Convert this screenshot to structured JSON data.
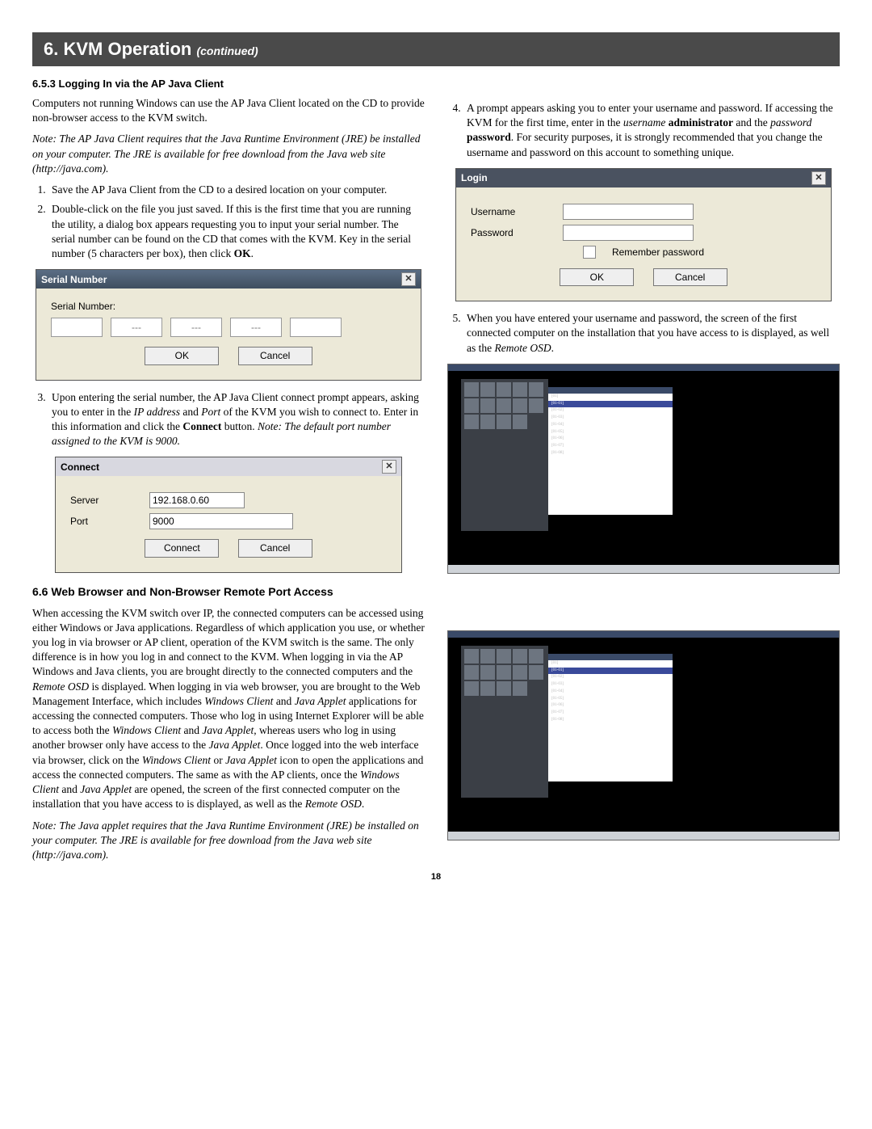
{
  "header": {
    "title": "6. KVM Operation",
    "continued": "(continued)"
  },
  "sec653_title": "6.5.3 Logging In via the AP Java Client",
  "left": {
    "p1": "Computers not running Windows can use the AP Java Client located on the CD to provide non-browser access to the KVM switch.",
    "note1": "Note: The AP Java Client requires that the Java Runtime Environment (JRE) be installed on your computer. The JRE is available for free download from the Java web site (http://java.com).",
    "step1": "Save the AP Java Client from the CD to a desired location on your computer.",
    "step2_pre": "Double-click on the file you just saved. If this is the first time that you are running the utility, a dialog box appears requesting you to input your serial number. The serial number can be found on the CD that comes with the KVM. Key in the serial number (5 characters per box), then click ",
    "step2_bold": "OK",
    "step2_post": ".",
    "step3_pre": "Upon entering the serial number, the AP Java Client connect prompt appears, asking you to enter in the ",
    "step3_i1": "IP address",
    "step3_mid1": " and ",
    "step3_i2": "Port",
    "step3_mid2": " of the KVM you wish to connect to. Enter in this information and click the ",
    "step3_b1": "Connect",
    "step3_mid3": " button. ",
    "step3_note": "Note: The default port number assigned to the KVM is 9000."
  },
  "serial_dialog": {
    "title": "Serial Number",
    "label": "Serial Number:",
    "dash": "---",
    "ok": "OK",
    "cancel": "Cancel"
  },
  "connect_dialog": {
    "title": "Connect",
    "server_label": "Server",
    "server_value": "192.168.0.60",
    "port_label": "Port",
    "port_value": "9000",
    "connect": "Connect",
    "cancel": "Cancel"
  },
  "right": {
    "step4_pre": "A prompt appears asking you to enter your username and password. If accessing the KVM for the first time, enter in the ",
    "step4_i1": "username",
    "sp": " ",
    "step4_b1": "administrator",
    "step4_mid1": " and the ",
    "step4_i2": "password",
    "step4_b2": "password",
    "step4_post": ". For security purposes, it is strongly recommended that you change the username and password on this account to something unique.",
    "step5_pre": "When you have entered your username and password, the screen of the first connected computer on the installation that you have access to is displayed, as well as the ",
    "step5_i1": "Remote OSD",
    "step5_post": "."
  },
  "login_dialog": {
    "title": "Login",
    "username": "Username",
    "password": "Password",
    "remember": "Remember password",
    "ok": "OK",
    "cancel": "Cancel"
  },
  "osd_list": [
    "[01]",
    "[01-01]",
    "[01-02]",
    "[01-03]",
    "[01-04]",
    "[01-05]",
    "[01-06]",
    "[01-07]",
    "[01-08]"
  ],
  "sec66": {
    "title": "6.6 Web Browser and Non-Browser Remote Port Access",
    "p_pre": "When accessing the KVM switch over IP, the connected computers can be accessed using either Windows or Java applications. Regardless of which application you use, or whether you log in via browser or AP client, operation of the KVM switch is the same. The only difference is in how you log in and connect to the KVM. When logging in via the AP Windows and Java clients, you are brought directly to the connected computers and the ",
    "i1": "Remote OSD",
    "m1": " is displayed. When logging in via web browser, you are brought to the Web Management Interface, which includes ",
    "i2": "Windows Client",
    "m2": " and ",
    "i3": "Java Applet",
    "m3": " applications for accessing the connected computers. Those who log in using Internet Explorer will be able to access both the ",
    "i4": "Windows Client",
    "m4": " and ",
    "i5": "Java Applet",
    "m5": ", whereas users who log in using another browser only have access to the ",
    "i6": "Java Applet",
    "m6": ". Once logged into the web interface via browser, click on the ",
    "i7": "Windows Client",
    "m7": " or ",
    "i8": "Java Applet",
    "m8": " icon to open the applications and access the connected computers. The same as with the AP clients, once the ",
    "i9": "Windows Client",
    "m9": " and ",
    "i10": "Java Applet",
    "m10": " are opened, the screen of the first connected computer on the installation that you have access to is displayed, as well as the ",
    "i11": "Remote OSD",
    "m11": ".",
    "note": "Note: The Java applet requires that the Java Runtime Environment (JRE) be installed on your computer. The JRE is available for free download from the Java web site (http://java.com)."
  },
  "page_number": "18"
}
